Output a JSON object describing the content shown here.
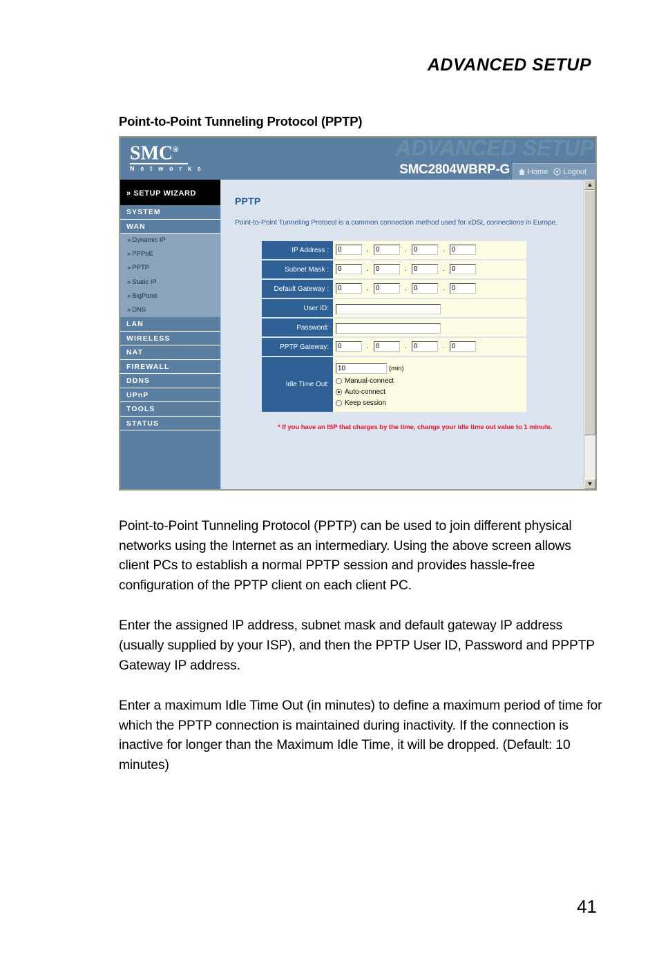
{
  "page": {
    "running_head": "ADVANCED SETUP",
    "section_heading": "Point-to-Point Tunneling Protocol (PPTP)",
    "page_number": "41"
  },
  "screenshot": {
    "brand": {
      "name": "SMC",
      "registered": "®",
      "tagline": "N e t w o r k s"
    },
    "header": {
      "ghost_title": "ADVANCED SETUP",
      "model": "SMC2804WBRP-G",
      "home_label": "Home",
      "logout_label": "Logout",
      "home_icon": "home-icon",
      "logout_icon": "logout-icon",
      "bg_color": "#5b7fa2",
      "ghost_color": "#6b8dac"
    },
    "sidebar": {
      "wizard": "» SETUP WIZARD",
      "items": [
        {
          "label": "SYSTEM",
          "type": "top"
        },
        {
          "label": "WAN",
          "type": "top"
        },
        {
          "label": "Dynamic IP",
          "type": "sub"
        },
        {
          "label": "PPPoE",
          "type": "sub"
        },
        {
          "label": "PPTP",
          "type": "sub"
        },
        {
          "label": "Static IP",
          "type": "sub"
        },
        {
          "label": "BigPond",
          "type": "sub"
        },
        {
          "label": "DNS",
          "type": "sub"
        },
        {
          "label": "LAN",
          "type": "top"
        },
        {
          "label": "WIRELESS",
          "type": "top"
        },
        {
          "label": "NAT",
          "type": "top"
        },
        {
          "label": "FIREWALL",
          "type": "top"
        },
        {
          "label": "DDNS",
          "type": "top"
        },
        {
          "label": "UPnP",
          "type": "top"
        },
        {
          "label": "TOOLS",
          "type": "top"
        },
        {
          "label": "STATUS",
          "type": "top"
        }
      ],
      "sub_bullet": "»"
    },
    "content": {
      "title": "PPTP",
      "description": "Point-to-Point Tunneling Protocol is a common connection method used for xDSL connections in Europe.",
      "title_color": "#2a5c94",
      "form": {
        "ip_address": {
          "label": "IP Address :",
          "octets": [
            "0",
            "0",
            "0",
            "0"
          ],
          "separator": "."
        },
        "subnet_mask": {
          "label": "Subnet Mask :",
          "octets": [
            "0",
            "0",
            "0",
            "0"
          ],
          "separator": "."
        },
        "default_gateway": {
          "label": "Default Gateway :",
          "octets": [
            "0",
            "0",
            "0",
            "0"
          ],
          "separator": "."
        },
        "user_id": {
          "label": "User ID:",
          "value": ""
        },
        "password": {
          "label": "Password:",
          "value": ""
        },
        "pptp_gateway": {
          "label": "PPTP Gateway:",
          "octets": [
            "0",
            "0",
            "0",
            "0"
          ],
          "separator": "."
        },
        "idle_time_out": {
          "label": "Idle Time Out:",
          "value": "10",
          "unit": "(min)",
          "options": [
            {
              "label": "Manual-connect",
              "selected": false
            },
            {
              "label": "Auto-connect",
              "selected": true
            },
            {
              "label": "Keep session",
              "selected": false
            }
          ]
        }
      },
      "note": "* If you have an ISP that charges by the time, change your idle time out value to 1 minute.",
      "note_color": "#e8142b"
    }
  },
  "body": {
    "paragraphs": [
      "Point-to-Point Tunneling Protocol (PPTP) can be used to join different physical networks using the Internet as an intermediary. Using the above screen allows client PCs to establish a normal PPTP session and provides hassle-free configuration of the PPTP client on each client PC.",
      "Enter the assigned IP address, subnet mask and default gateway IP address (usually supplied by your ISP), and then the PPTP User ID, Password and PPPTP Gateway IP address.",
      "Enter a maximum Idle Time Out (in minutes) to define a maximum period of time for which the PPTP connection is maintained during inactivity. If the connection is inactive for longer than the Maximum Idle Time, it will be dropped. (Default: 10 minutes)"
    ]
  }
}
